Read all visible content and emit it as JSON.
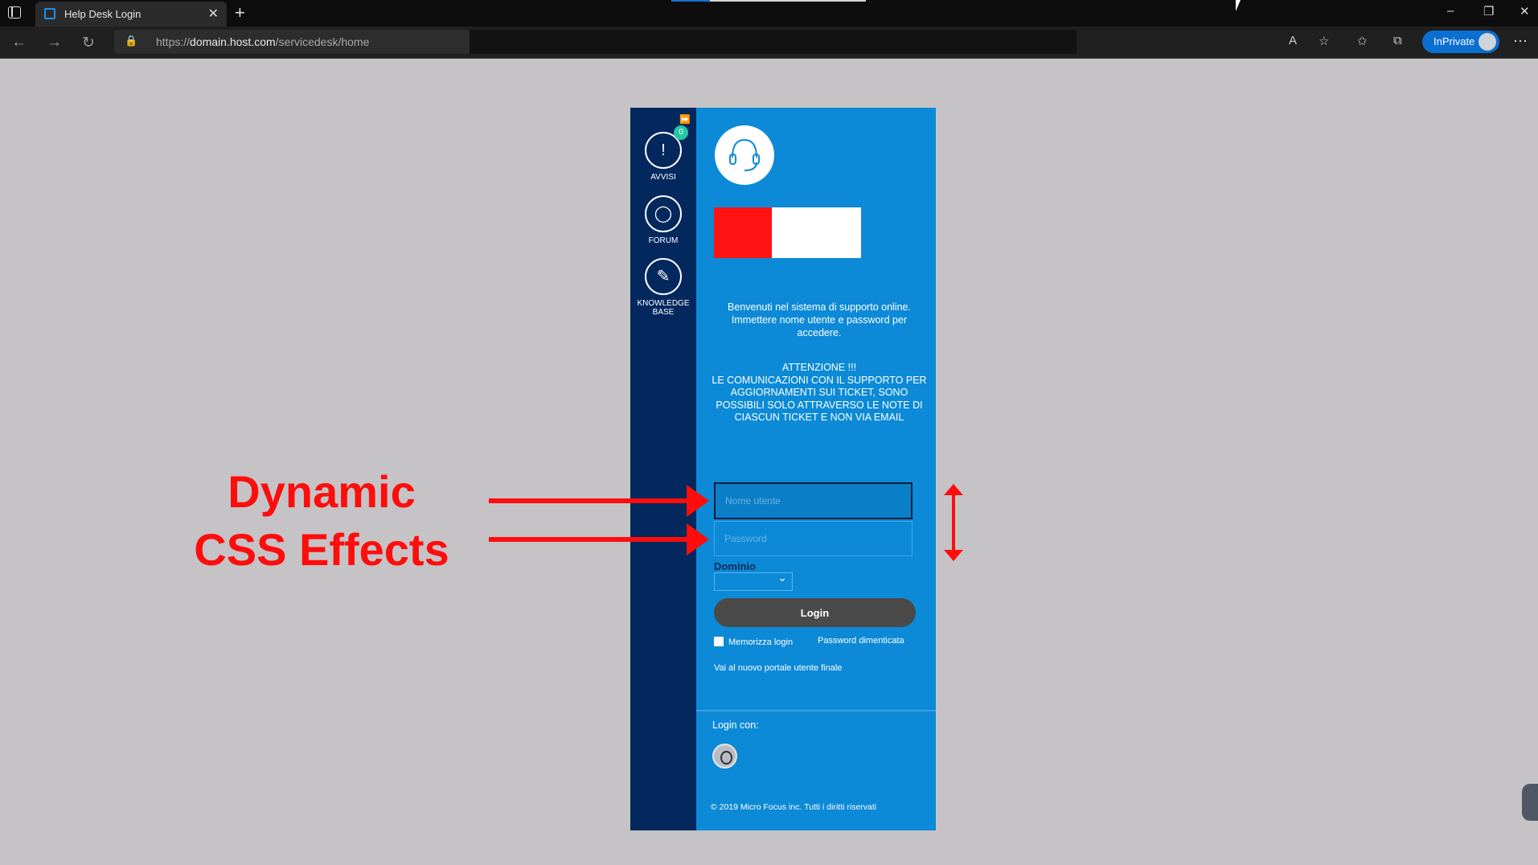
{
  "browser": {
    "tab_title": "Help Desk Login",
    "url_prefix": "https://",
    "url_domain": "domain.host.com",
    "url_path": "/servicedesk/home",
    "inprivate_label": "InPrivate"
  },
  "sidebar": {
    "items": [
      {
        "label": "AVVISI",
        "badge": "0",
        "icon": "alert-icon"
      },
      {
        "label": "FORUM",
        "icon": "chat-icon"
      },
      {
        "label": "KNOWLEDGE BASE",
        "icon": "wrench-icon"
      }
    ]
  },
  "login": {
    "intro": "Benvenuti nel sistema di supporto online. Immettere nome utente e password per accedere.",
    "warning_title": "ATTENZIONE !!!",
    "warning_body": "LE COMUNICAZIONI CON IL SUPPORTO PER AGGIORNAMENTI SUI TICKET, SONO POSSIBILI SOLO ATTRAVERSO LE NOTE DI CIASCUN TICKET E NON VIA EMAIL",
    "username_placeholder": "Nome utente",
    "password_placeholder": "Password",
    "domain_label": "Dominio",
    "login_button": "Login",
    "remember_label": "Memorizza login",
    "forgot_link": "Password dimenticata",
    "portal_link": "Vai al nuovo portale utente finale",
    "login_with": "Login con:",
    "copyright": "© 2019 Micro Focus inc. Tutti i diritti riservati"
  },
  "annotation": {
    "line1": "Dynamic",
    "line2": "CSS Effects"
  },
  "colors": {
    "sidebar_bg": "#03285e",
    "main_bg": "#0c8ad7",
    "annotation": "#ff0d0d",
    "badge": "#26c6a6",
    "page_bg": "#c5c3c6"
  }
}
